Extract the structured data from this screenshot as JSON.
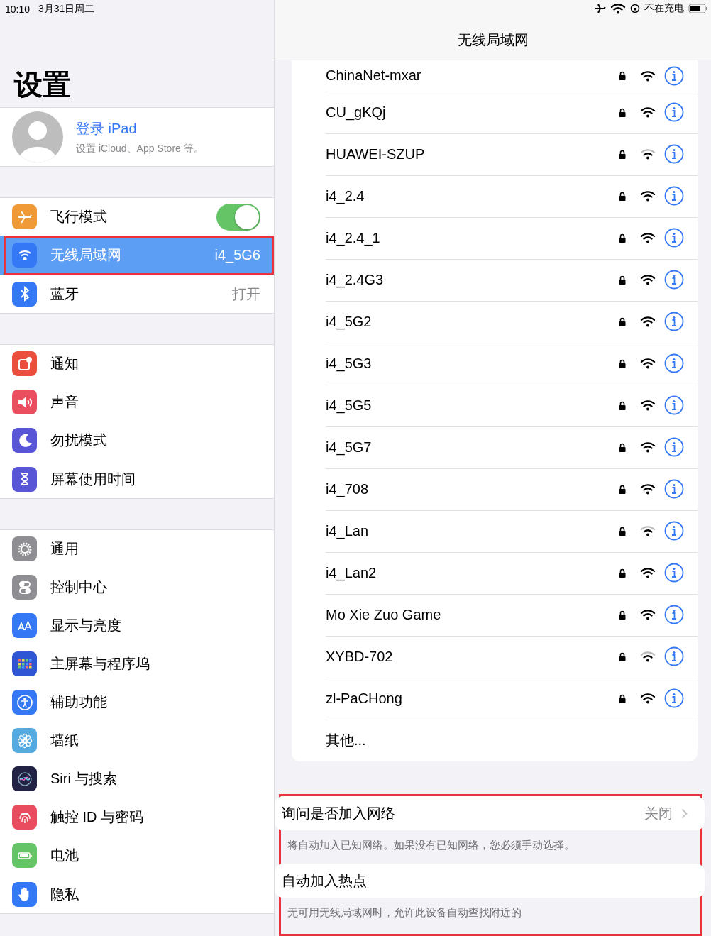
{
  "status_bar": {
    "time": "10:10",
    "date": "3月31日周二",
    "charging": "不在充电"
  },
  "sidebar": {
    "title": "设置",
    "account": {
      "name": "登录 iPad",
      "subtitle": "设置 iCloud、App Store 等。"
    },
    "groups": [
      [
        {
          "kind": "airplane",
          "label": "飞行模式",
          "toggle": true,
          "selected": false
        },
        {
          "kind": "wifi",
          "label": "无线局域网",
          "value": "i4_5G6",
          "selected": true,
          "highlighted": true
        },
        {
          "kind": "bluetooth",
          "label": "蓝牙",
          "value": "打开",
          "selected": false
        }
      ],
      [
        {
          "kind": "notifications",
          "label": "通知",
          "selected": false
        },
        {
          "kind": "sound",
          "label": "声音",
          "selected": false
        },
        {
          "kind": "moon",
          "label": "勿扰模式",
          "selected": false
        },
        {
          "kind": "hourglass",
          "label": "屏幕使用时间",
          "selected": false
        }
      ],
      [
        {
          "kind": "gear",
          "label": "通用",
          "selected": false
        },
        {
          "kind": "switches",
          "label": "控制中心",
          "selected": false
        },
        {
          "kind": "textsize",
          "label": "显示与亮度",
          "selected": false
        },
        {
          "kind": "grid",
          "label": "主屏幕与程序坞",
          "selected": false
        },
        {
          "kind": "accessibility",
          "label": "辅助功能",
          "selected": false
        },
        {
          "kind": "flower",
          "label": "墙纸",
          "selected": false
        },
        {
          "kind": "siri",
          "label": "Siri 与搜索",
          "selected": false
        },
        {
          "kind": "fingerprint",
          "label": "触控 ID 与密码",
          "selected": false
        },
        {
          "kind": "battery",
          "label": "电池",
          "selected": false
        },
        {
          "kind": "hand",
          "label": "隐私",
          "selected": false
        }
      ]
    ]
  },
  "detail": {
    "title": "无线局域网",
    "networks": [
      {
        "name": "ChinaNet-mxar",
        "locked": true,
        "strong_signal": true
      },
      {
        "name": "CU_gKQj",
        "locked": true,
        "strong_signal": true
      },
      {
        "name": "HUAWEI-SZUP",
        "locked": true,
        "strong_signal": false
      },
      {
        "name": "i4_2.4",
        "locked": true,
        "strong_signal": true
      },
      {
        "name": "i4_2.4_1",
        "locked": true,
        "strong_signal": true
      },
      {
        "name": "i4_2.4G3",
        "locked": true,
        "strong_signal": true
      },
      {
        "name": "i4_5G2",
        "locked": true,
        "strong_signal": true
      },
      {
        "name": "i4_5G3",
        "locked": true,
        "strong_signal": true
      },
      {
        "name": "i4_5G5",
        "locked": true,
        "strong_signal": true
      },
      {
        "name": "i4_5G7",
        "locked": true,
        "strong_signal": true
      },
      {
        "name": "i4_708",
        "locked": true,
        "strong_signal": true
      },
      {
        "name": "i4_Lan",
        "locked": true,
        "strong_signal": false
      },
      {
        "name": "i4_Lan2",
        "locked": true,
        "strong_signal": true
      },
      {
        "name": "Mo Xie Zuo Game",
        "locked": true,
        "strong_signal": true
      },
      {
        "name": "XYBD-702",
        "locked": true,
        "strong_signal": false
      },
      {
        "name": "zl-PaCHong",
        "locked": true,
        "strong_signal": true
      }
    ],
    "other": "其他...",
    "options": [
      {
        "label": "询问是否加入网络",
        "value": "关闭",
        "footer": "将自动加入已知网络。如果没有已知网络，您必须手动选择。"
      },
      {
        "label": "自动加入热点",
        "footer": "无可用无线局域网时，允许此设备自动查找附近的"
      }
    ],
    "options_highlighted": true
  }
}
